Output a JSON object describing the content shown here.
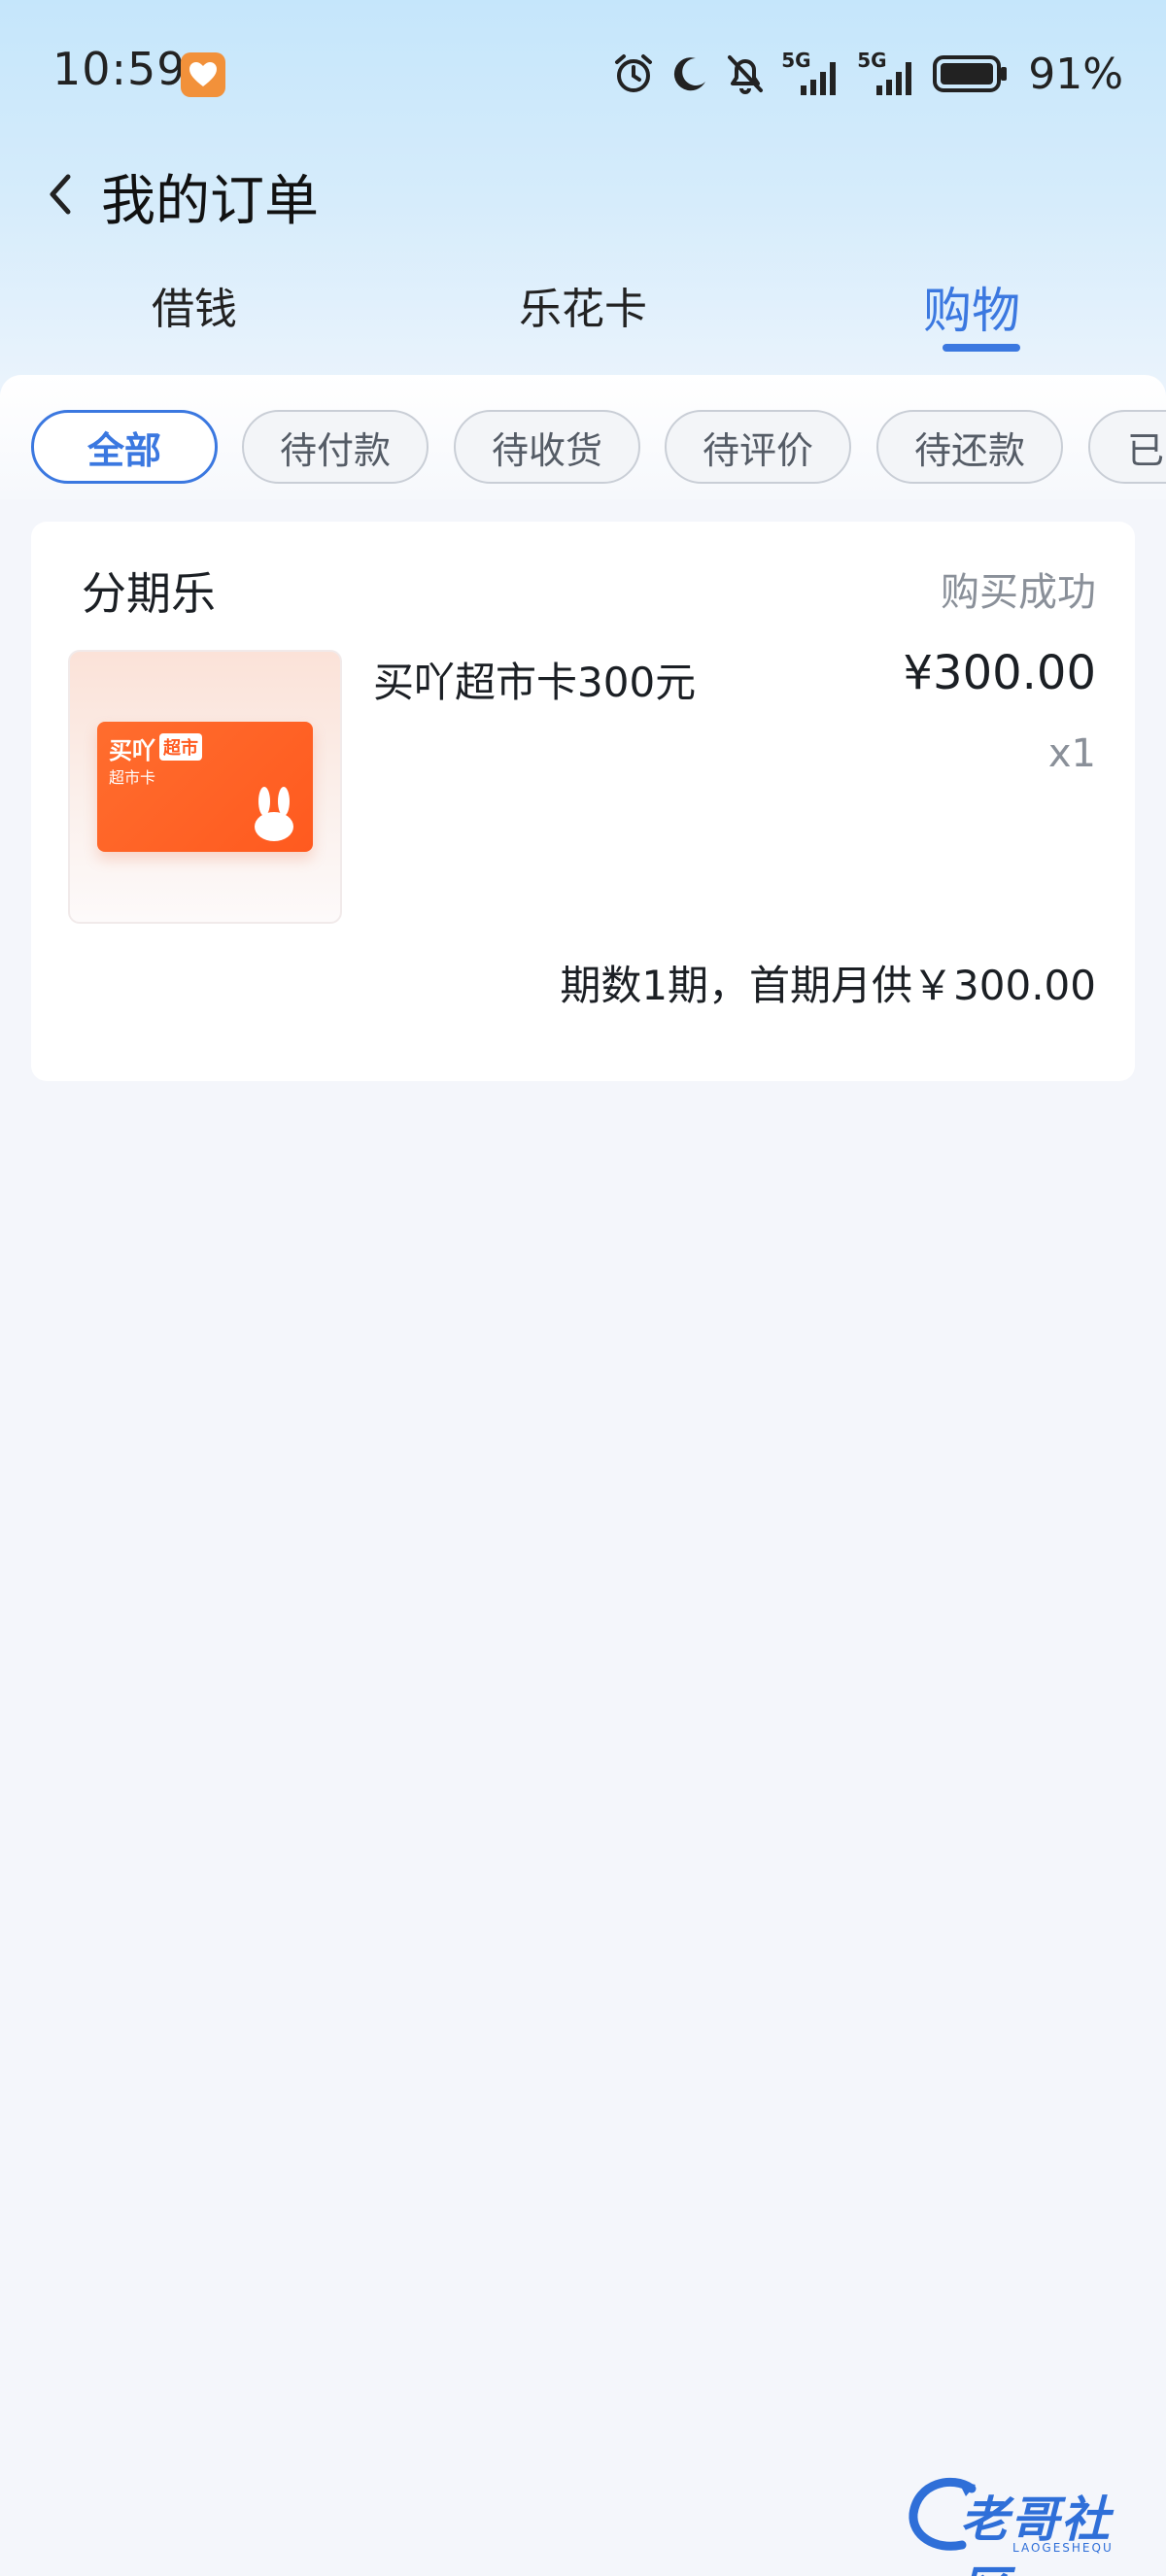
{
  "status_bar": {
    "time": "10:59",
    "network_1": "5G",
    "network_2": "5G",
    "battery_percent": "91%",
    "icons": [
      "app-heart-icon",
      "alarm-icon",
      "moon-icon",
      "bell-muted-icon",
      "signal-icon",
      "signal-icon",
      "battery-icon"
    ]
  },
  "header": {
    "title": "我的订单",
    "back_icon": "chevron-left-icon"
  },
  "top_tabs": [
    {
      "label": "借钱",
      "active": false
    },
    {
      "label": "乐花卡",
      "active": false
    },
    {
      "label": "购物",
      "active": true
    }
  ],
  "filters": [
    {
      "label": "全部",
      "active": true
    },
    {
      "label": "待付款",
      "active": false
    },
    {
      "label": "待收货",
      "active": false
    },
    {
      "label": "待评价",
      "active": false
    },
    {
      "label": "待还款",
      "active": false
    },
    {
      "label": "已",
      "active": false
    }
  ],
  "order": {
    "shop": "分期乐",
    "status": "购买成功",
    "product": {
      "name": "买吖超市卡300元",
      "price": "¥300.00",
      "quantity": "x1",
      "image_brand": "买吖",
      "image_tag": "超市",
      "image_sub": "超市卡"
    },
    "installment_text": "期数1期，首期月供￥300.00"
  },
  "watermark": {
    "text": "老哥社区",
    "sub": "LAOGESHEQU"
  },
  "colors": {
    "accent": "#3b78e0",
    "card_orange": "#ff5a1f",
    "muted_text": "#8a9099"
  }
}
